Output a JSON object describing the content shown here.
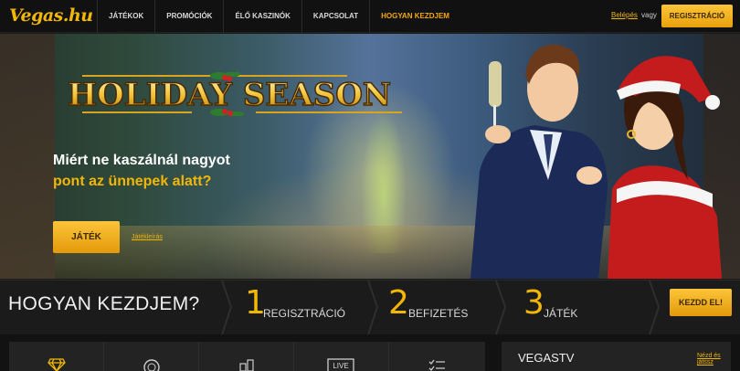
{
  "header": {
    "logo": "Vegas.hu",
    "nav": [
      "JÁTÉKOK",
      "PROMÓCIÓK",
      "ÉLŐ KASZINÓK",
      "KAPCSOLAT",
      "HOGYAN KEZDJEM"
    ],
    "login_label": "Belépés",
    "or_label": "vagy",
    "register_label": "REGISZTRÁCIÓ"
  },
  "hero": {
    "title": "HOLIDAY SEASON",
    "line1": "Miért ne kaszálnál nagyot",
    "line2": "pont az ünnepek alatt?",
    "play_label": "JÁTÉK",
    "terms_label": "Játékleírás"
  },
  "howto": {
    "title": "HOGYAN KEZDJEM?",
    "steps": [
      {
        "num": "1",
        "label": "REGISZTRÁCIÓ"
      },
      {
        "num": "2",
        "label": "BEFIZETÉS"
      },
      {
        "num": "3",
        "label": "JÁTÉK"
      }
    ],
    "start_label": "KEZDD EL!"
  },
  "bottom": {
    "categories": [
      "diamond-icon",
      "chip-icon",
      "coins-icon",
      "live-icon",
      "list-icon"
    ],
    "live_badge": "LIVE",
    "tv_title": "VEGASTV",
    "tv_link": "Nézd és játssz"
  },
  "colors": {
    "accent": "#f2b705",
    "button": "#f5b21c",
    "background": "#1a1a1a"
  }
}
